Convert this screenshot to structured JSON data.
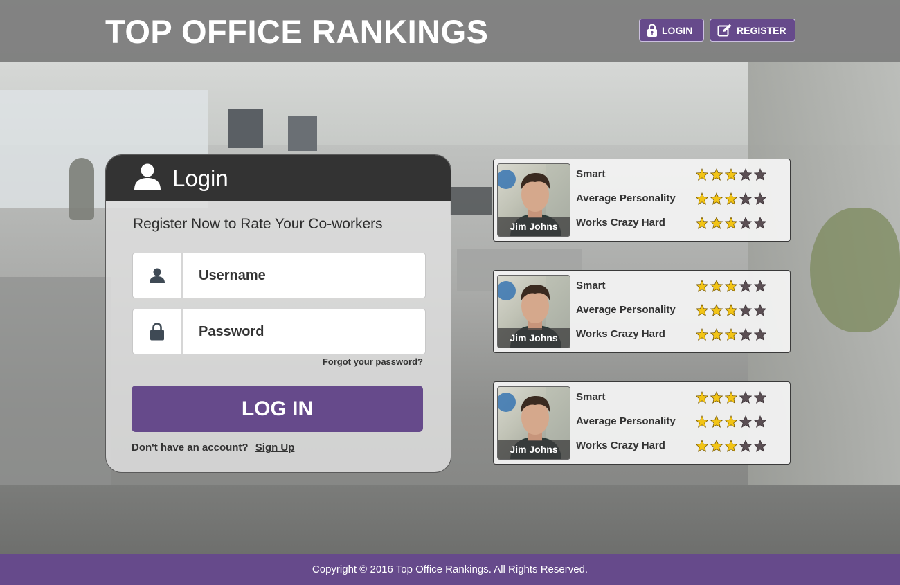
{
  "header": {
    "site_title": "TOP OFFICE RANKINGS",
    "login_label": "LOGIN",
    "register_label": "REGISTER"
  },
  "login_card": {
    "title": "Login",
    "subtitle": "Register Now to Rate Your Co-workers",
    "username_placeholder": "Username",
    "password_placeholder": "Password",
    "forgot_label": "Forgot your password?",
    "login_button_label": "LOG IN",
    "no_account_text": "Don't have an account?",
    "signup_label": "Sign Up"
  },
  "ratings": [
    {
      "name": "Jim Johns",
      "traits": [
        {
          "label": "Smart",
          "stars": 3,
          "max": 5
        },
        {
          "label": "Average Personality",
          "stars": 3,
          "max": 5
        },
        {
          "label": "Works Crazy Hard",
          "stars": 3,
          "max": 5
        }
      ]
    },
    {
      "name": "Jim Johns",
      "traits": [
        {
          "label": "Smart",
          "stars": 3,
          "max": 5
        },
        {
          "label": "Average Personality",
          "stars": 3,
          "max": 5
        },
        {
          "label": "Works Crazy Hard",
          "stars": 3,
          "max": 5
        }
      ]
    },
    {
      "name": "Jim Johns",
      "traits": [
        {
          "label": "Smart",
          "stars": 3,
          "max": 5
        },
        {
          "label": "Average Personality",
          "stars": 3,
          "max": 5
        },
        {
          "label": "Works Crazy Hard",
          "stars": 3,
          "max": 5
        }
      ]
    }
  ],
  "footer": {
    "copyright": "Copyright © 2016 Top Office Rankings. All Rights Reserved."
  },
  "colors": {
    "brand_purple": "#664a8b",
    "card_header": "#333333",
    "star_filled": "#f2c416",
    "star_empty": "#5b4f54"
  },
  "icons": {
    "login": "lock-icon",
    "register": "edit-icon",
    "login_header": "user-icon",
    "username": "user-icon",
    "password": "lock-icon",
    "rating": "star-icon"
  }
}
